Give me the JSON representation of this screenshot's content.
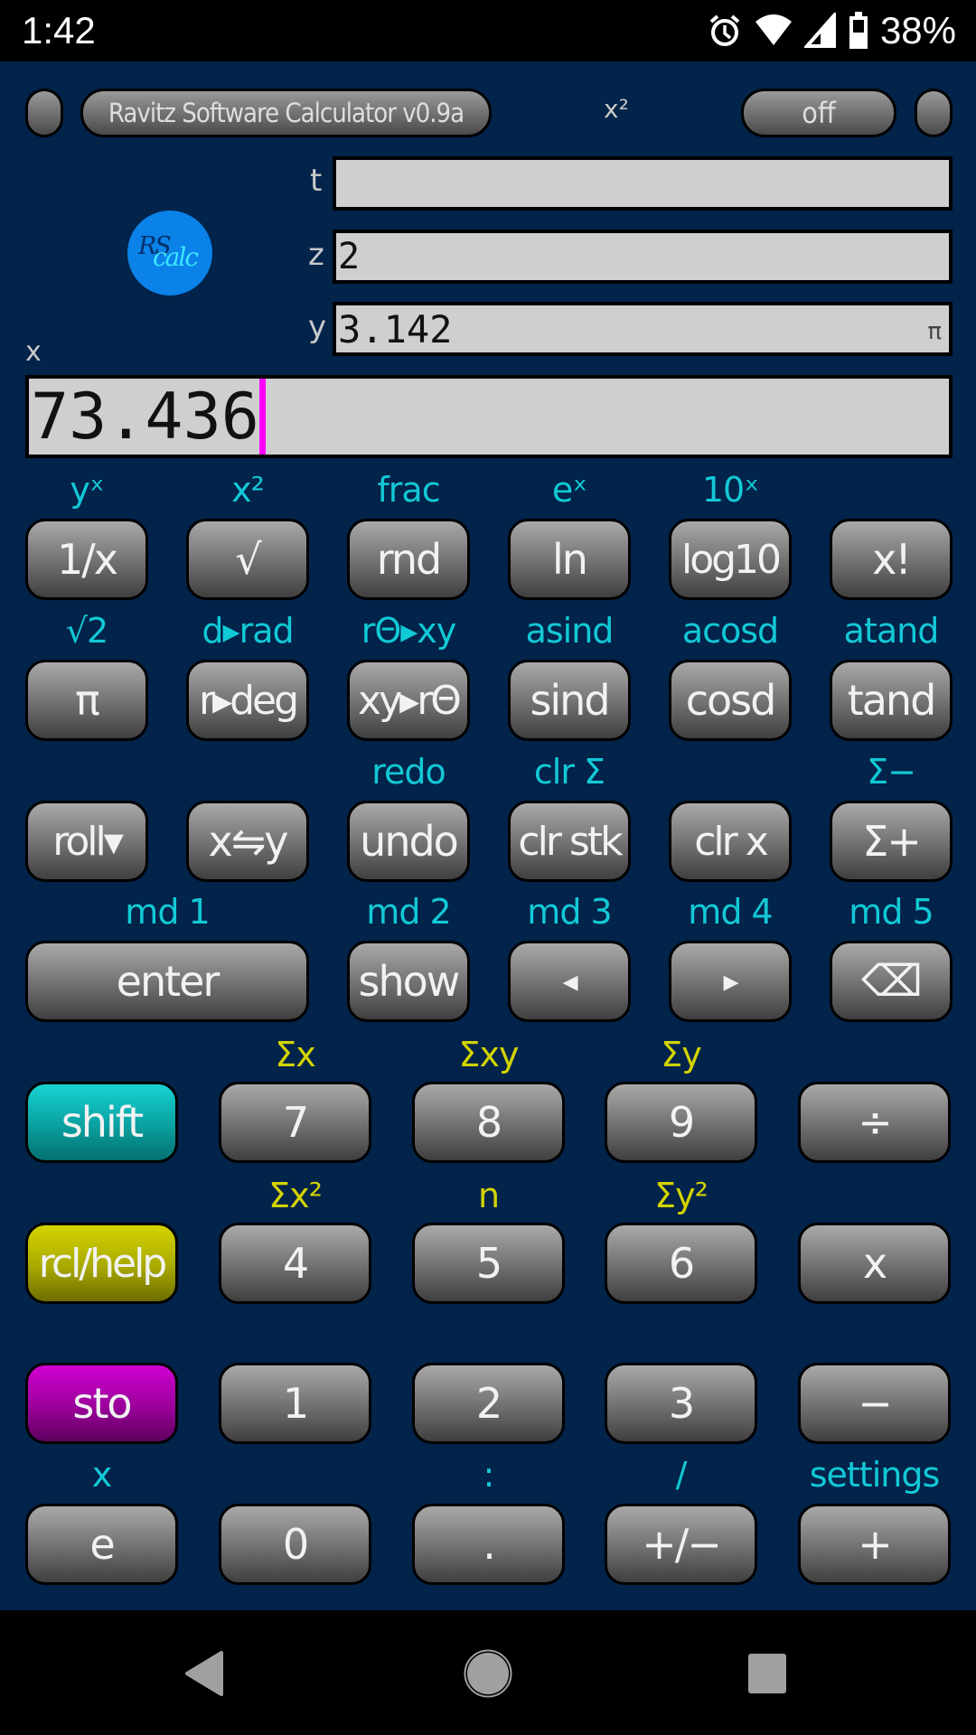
{
  "status_bar": {
    "time": "1:42",
    "icons": [
      "alarm-icon",
      "wifi-icon",
      "cell-signal-icon",
      "battery-icon"
    ],
    "battery_percent": "38%"
  },
  "top_bar": {
    "title_button": "Ravitz Software Calculator v0.9a",
    "indicator": "x²",
    "off_button": "off"
  },
  "logo": {
    "rs": "RS",
    "calc": "calc"
  },
  "registers": {
    "t": {
      "label": "t",
      "value": ""
    },
    "z": {
      "label": "z",
      "value": "2"
    },
    "y": {
      "label": "y",
      "value": "3.142",
      "tag": "π"
    },
    "x": {
      "label": "x",
      "value": "73.436"
    }
  },
  "colors": {
    "background": "#02234a",
    "shift_label": "#12c9d6",
    "stat_label": "#d3d300",
    "shift_key": "#0aa0a0",
    "rcl_key": "#a8a800",
    "sto_key": "#9a009a",
    "cursor": "#ff00ff"
  },
  "keys_six": [
    [
      {
        "label": "1/x",
        "shift": "yˣ"
      },
      {
        "label": "√",
        "shift": "x²"
      },
      {
        "label": "rnd",
        "shift": "frac"
      },
      {
        "label": "ln",
        "shift": "eˣ"
      },
      {
        "label": "log10",
        "shift": "10ˣ"
      },
      {
        "label": "x!",
        "shift": ""
      }
    ],
    [
      {
        "label": "π",
        "shift": "√2"
      },
      {
        "label": "r▸deg",
        "shift": "d▸rad"
      },
      {
        "label": "xy▸rΘ",
        "shift": "rΘ▸xy"
      },
      {
        "label": "sind",
        "shift": "asind"
      },
      {
        "label": "cosd",
        "shift": "acosd"
      },
      {
        "label": "tand",
        "shift": "atand"
      }
    ],
    [
      {
        "label": "roll▾",
        "shift": ""
      },
      {
        "label": "x⇋y",
        "shift": ""
      },
      {
        "label": "undo",
        "shift": "redo"
      },
      {
        "label": "clr stk",
        "shift": "clr Σ"
      },
      {
        "label": "clr x",
        "shift": ""
      },
      {
        "label": "Σ+",
        "shift": "Σ−"
      }
    ]
  ],
  "keys_enter_row": [
    {
      "label": "enter",
      "shift": "md 1"
    },
    {
      "label": "show",
      "shift": "md 2"
    },
    {
      "label": "◂",
      "shift": "md 3"
    },
    {
      "label": "▸",
      "shift": "md 4"
    },
    {
      "label": "⌫",
      "shift": "md 5"
    }
  ],
  "keys_five": [
    [
      {
        "label": "shift",
        "shift": "",
        "stat": ""
      },
      {
        "label": "7",
        "shift": "",
        "stat": "Σx"
      },
      {
        "label": "8",
        "shift": "",
        "stat": "Σxy"
      },
      {
        "label": "9",
        "shift": "",
        "stat": "Σy"
      },
      {
        "label": "÷",
        "shift": "",
        "stat": ""
      }
    ],
    [
      {
        "label": "rcl/help",
        "shift": "",
        "stat": ""
      },
      {
        "label": "4",
        "shift": "",
        "stat": "Σx²"
      },
      {
        "label": "5",
        "shift": "",
        "stat": "n"
      },
      {
        "label": "6",
        "shift": "",
        "stat": "Σy²"
      },
      {
        "label": "x",
        "shift": "",
        "stat": ""
      }
    ],
    [
      {
        "label": "sto",
        "shift": "",
        "stat": ""
      },
      {
        "label": "1",
        "shift": "",
        "stat": ""
      },
      {
        "label": "2",
        "shift": "",
        "stat": ""
      },
      {
        "label": "3",
        "shift": "",
        "stat": ""
      },
      {
        "label": "−",
        "shift": "",
        "stat": ""
      }
    ],
    [
      {
        "label": "e",
        "shift": "x",
        "stat": ""
      },
      {
        "label": "0",
        "shift": "",
        "stat": ""
      },
      {
        "label": ".",
        "shift": ":",
        "stat": ""
      },
      {
        "label": "+/−",
        "shift": "/",
        "stat": ""
      },
      {
        "label": "+",
        "shift": "settings",
        "stat": ""
      }
    ]
  ],
  "nav_bar": {
    "icons": [
      "back-icon",
      "home-icon",
      "recents-icon"
    ]
  }
}
